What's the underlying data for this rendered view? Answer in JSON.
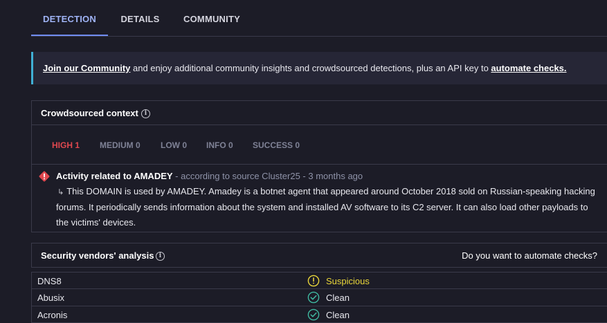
{
  "tabs": [
    {
      "label": "DETECTION",
      "active": true
    },
    {
      "label": "DETAILS",
      "active": false
    },
    {
      "label": "COMMUNITY",
      "active": false
    }
  ],
  "banner": {
    "link1": "Join our Community",
    "text": " and enjoy additional community insights and crowdsourced detections, plus an API key to ",
    "link2": "automate checks."
  },
  "crowdsourced": {
    "title": "Crowdsourced context",
    "severity": {
      "high": "HIGH 1",
      "medium": "MEDIUM 0",
      "low": "LOW 0",
      "info": "INFO 0",
      "success": "SUCCESS 0"
    },
    "alert": {
      "title": "Activity related to AMADEY",
      "source": " - according to source Cluster25 - 3 months ago",
      "text": "This DOMAIN is used by AMADEY. Amadey is a botnet agent that appeared around October 2018 sold on Russian-speaking hacking forums. It periodically sends information about the system and installed AV software to its C2 server. It can also load other payloads to the victims' devices."
    }
  },
  "vendors": {
    "title": "Security vendors' analysis",
    "automate": "Do you want to automate checks?",
    "rows": [
      {
        "name": "DNS8",
        "result": "Suspicious",
        "icon": "warning-circle-icon"
      },
      {
        "name": "Abusix",
        "result": "Clean",
        "icon": "check-circle-icon"
      },
      {
        "name": "Acronis",
        "result": "Clean",
        "icon": "check-circle-icon"
      }
    ]
  },
  "colors": {
    "background": "#1c1c27",
    "accent": "#6f8cf0",
    "high": "#e0484f",
    "suspicious": "#e9d63a",
    "clean": "#3fb8a0"
  }
}
